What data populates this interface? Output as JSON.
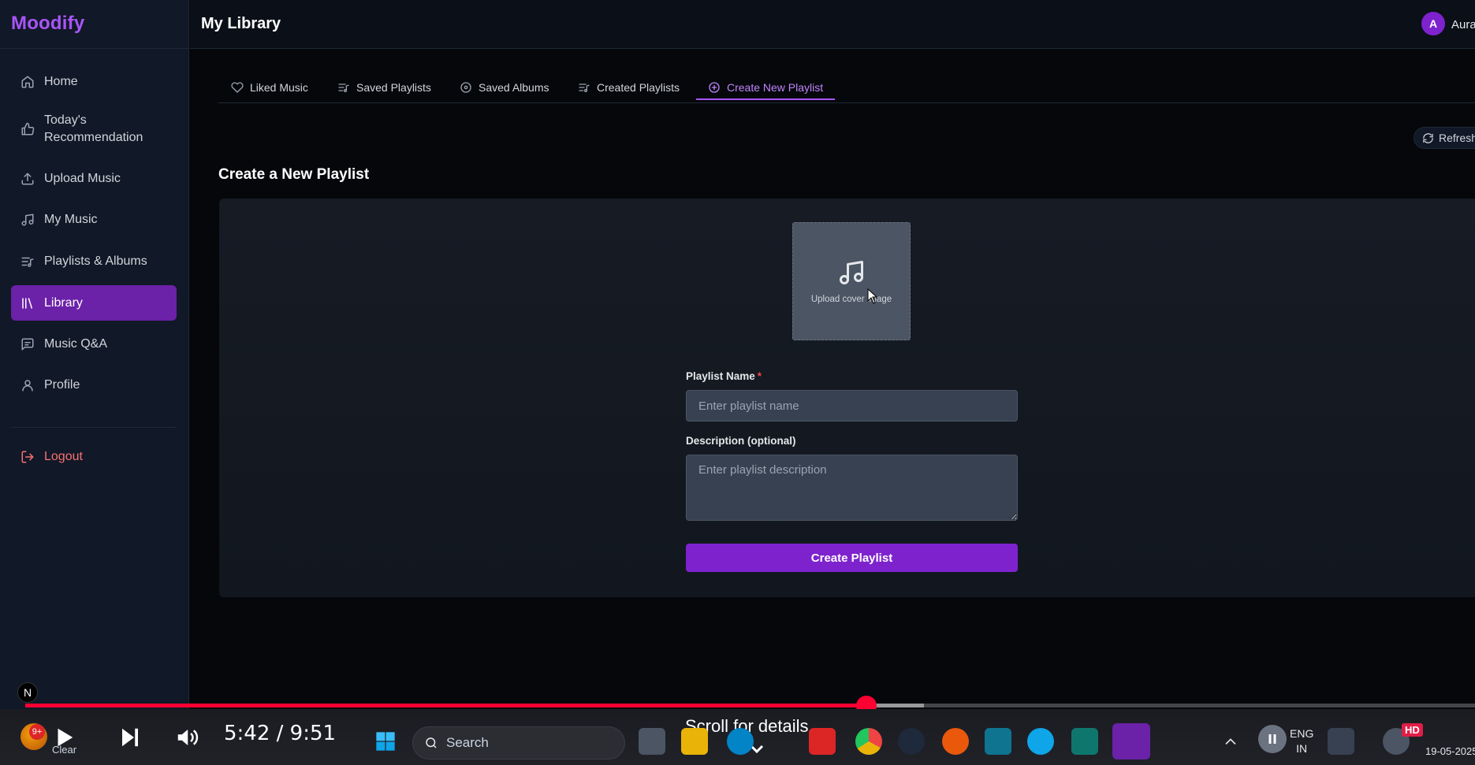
{
  "app": {
    "brand": "Moodify",
    "page_title": "My Library",
    "user": {
      "avatar_letter": "A",
      "name": "Aura"
    }
  },
  "sidebar": {
    "items": [
      {
        "label": "Home",
        "icon": "home-icon"
      },
      {
        "label": "Today's Recommendation",
        "icon": "thumbs-up-icon"
      },
      {
        "label": "Upload Music",
        "icon": "upload-icon"
      },
      {
        "label": "My Music",
        "icon": "music-note-icon"
      },
      {
        "label": "Playlists & Albums",
        "icon": "list-music-icon"
      },
      {
        "label": "Library",
        "icon": "library-icon",
        "active": true
      },
      {
        "label": "Music Q&A",
        "icon": "chat-icon"
      },
      {
        "label": "Profile",
        "icon": "user-icon"
      }
    ],
    "logout_label": "Logout",
    "bottom_badge": "N"
  },
  "tabs": [
    {
      "label": "Liked Music",
      "icon": "heart-icon"
    },
    {
      "label": "Saved Playlists",
      "icon": "list-music-icon"
    },
    {
      "label": "Saved Albums",
      "icon": "disc-icon"
    },
    {
      "label": "Created Playlists",
      "icon": "list-music-icon"
    },
    {
      "label": "Create New Playlist",
      "icon": "plus-circle-icon",
      "active": true
    }
  ],
  "refresh_label": "Refresh",
  "form": {
    "section_title": "Create a New Playlist",
    "cover_label": "Upload cover image",
    "name_label": "Playlist Name",
    "name_required_mark": "*",
    "name_placeholder": "Enter playlist name",
    "description_label": "Description (optional)",
    "description_placeholder": "Enter playlist description",
    "submit_label": "Create Playlist"
  },
  "player": {
    "time": "5:42 / 9:51",
    "progress_fraction": 0.58,
    "buffered_fraction": 0.62,
    "scroll_hint": "Scroll for details",
    "hd_badge": "HD"
  },
  "taskbar": {
    "weather_badge": "9+",
    "weather_label": "Clear",
    "search_placeholder": "Search",
    "language_line1": "ENG",
    "language_line2": "IN",
    "date": "19-05-2025"
  },
  "colors": {
    "accent": "#a855f7",
    "active_bg": "#6b21a8",
    "button": "#7e22ce",
    "progress": "#ff0033",
    "danger": "#f87171"
  }
}
